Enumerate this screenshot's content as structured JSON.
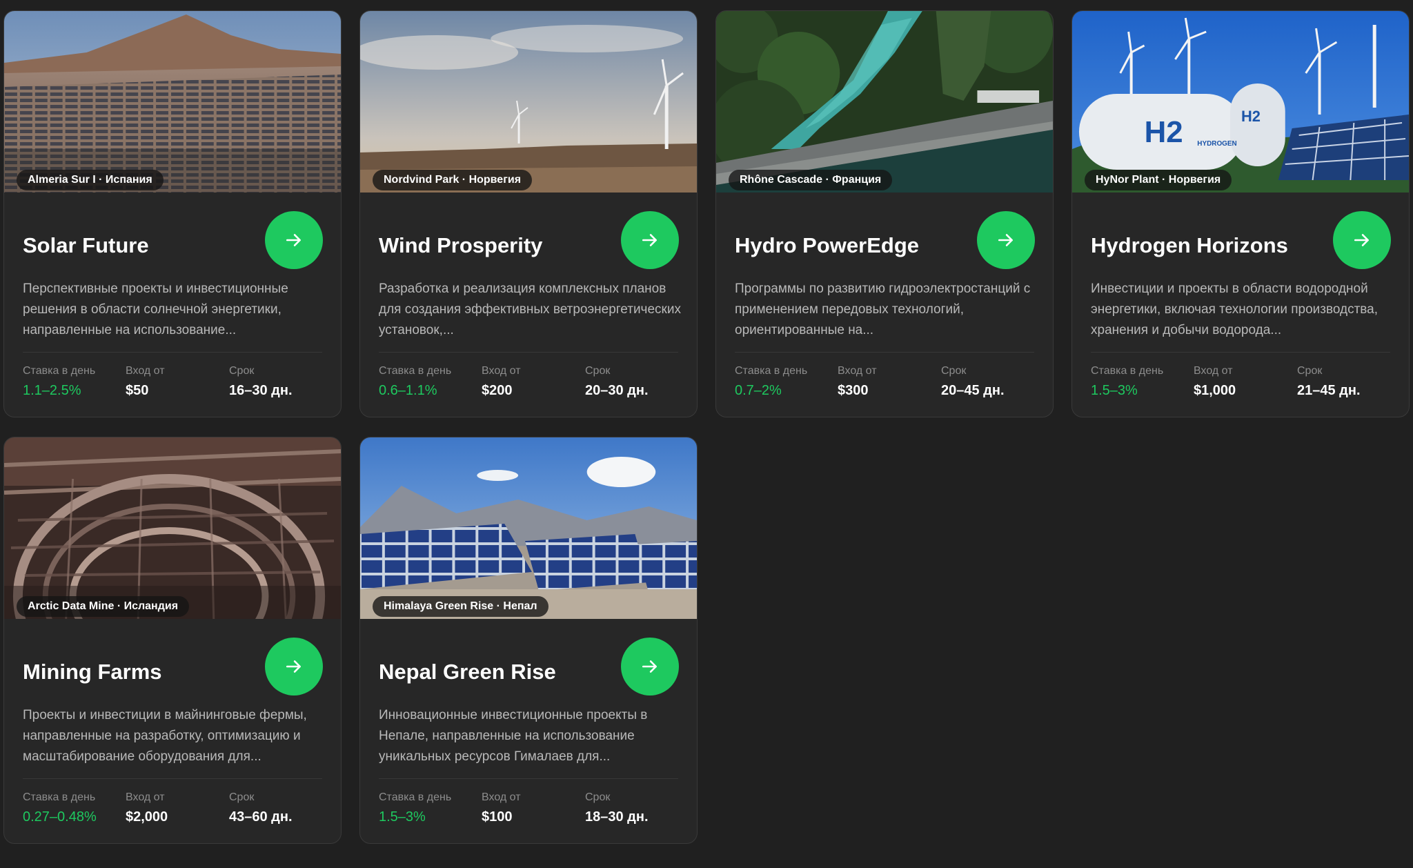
{
  "labels": {
    "rate": "Ставка в день",
    "entry": "Вход от",
    "term": "Срок"
  },
  "accent_color": "#1ec95f",
  "cards": [
    {
      "location": "Almeria Sur I · Испания",
      "title": "Solar Future",
      "description": "Перспективные проекты и инвестиционные решения в области солнечной энергетики, направленные на использование...",
      "rate": "1.1–2.5%",
      "entry": "$50",
      "term": "16–30 дн.",
      "image": "solar-desert-photo"
    },
    {
      "location": "Nordvind Park · Норвегия",
      "title": "Wind Prosperity",
      "description": "Разработка и реализация комплексных планов для создания эффективных ветроэнергетических установок,...",
      "rate": "0.6–1.1%",
      "entry": "$200",
      "term": "20–30 дн.",
      "image": "wind-turbines-photo"
    },
    {
      "location": "Rhône Cascade · Франция",
      "title": "Hydro PowerEdge",
      "description": "Программы по развитию гидроэлектростанций с применением передовых технологий, ориентированные на...",
      "rate": "0.7–2%",
      "entry": "$300",
      "term": "20–45 дн.",
      "image": "hydro-dam-photo"
    },
    {
      "location": "HyNor Plant · Норвегия",
      "title": "Hydrogen Horizons",
      "description": "Инвестиции и проекты в области водородной энергетики, включая технологии производства, хранения и добычи водорода...",
      "rate": "1.5–3%",
      "entry": "$1,000",
      "term": "21–45 дн.",
      "image": "hydrogen-tanks-photo",
      "image_text": [
        "H2",
        "H2",
        "HYDROGEN"
      ]
    },
    {
      "location": "Arctic Data Mine · Исландия",
      "title": "Mining Farms",
      "description": "Проекты и инвестиции в майнинговые фермы, направленные на разработку, оптимизацию и масштабирование оборудования для...",
      "rate": "0.27–0.48%",
      "entry": "$2,000",
      "term": "43–60 дн.",
      "image": "mining-farm-photo"
    },
    {
      "location": "Himalaya Green Rise · Непал",
      "title": "Nepal Green Rise",
      "description": "Инновационные инвестиционные проекты в Непале, направленные на использование уникальных ресурсов Гималаев для...",
      "rate": "1.5–3%",
      "entry": "$100",
      "term": "18–30 дн.",
      "image": "mountain-solar-photo"
    }
  ]
}
